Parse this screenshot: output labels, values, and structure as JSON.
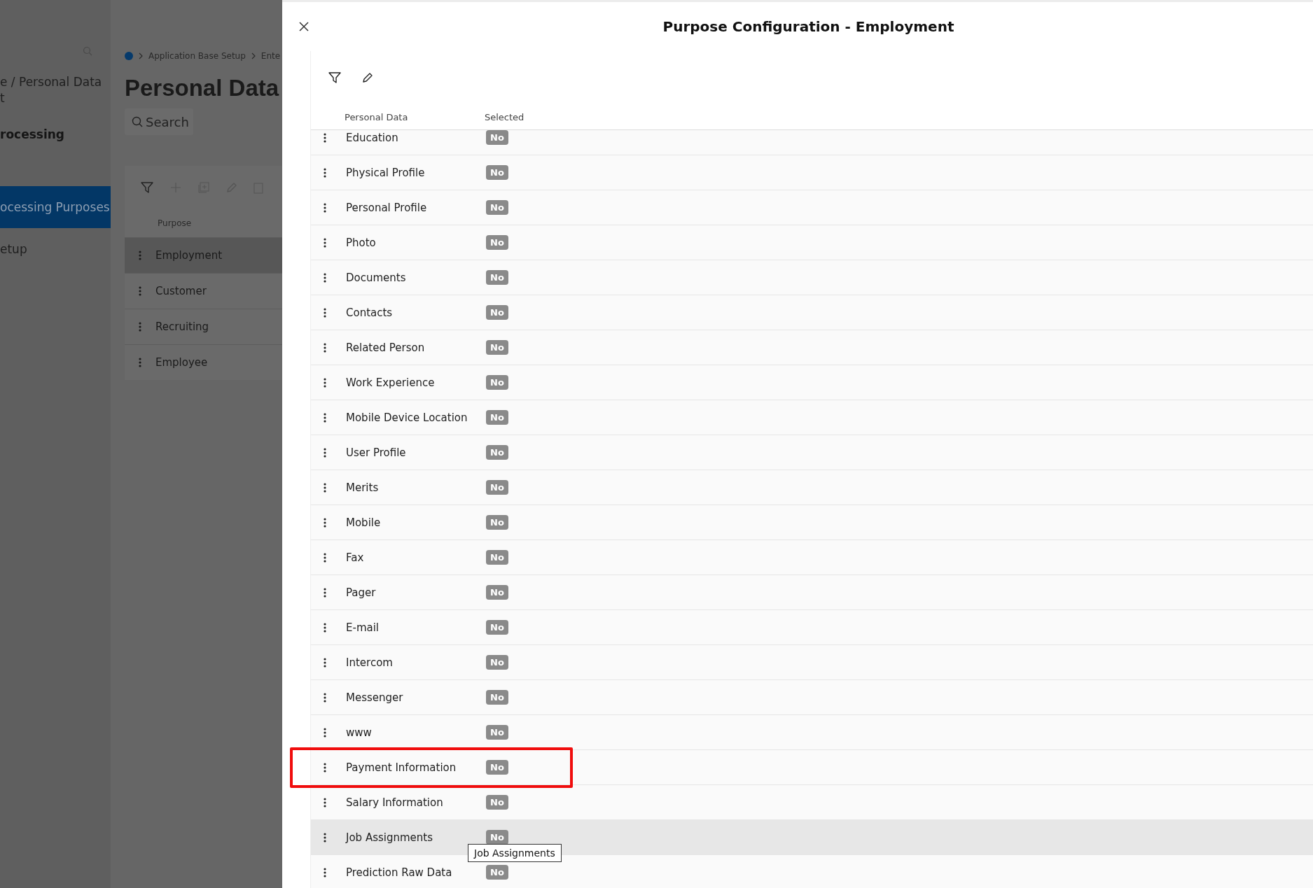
{
  "background": {
    "sidebar": {
      "heading_lines": [
        "e / Personal Data",
        "t"
      ],
      "section": "rocessing",
      "items": [
        {
          "label": "ocessing Purposes",
          "selected": true
        },
        {
          "label": "etup",
          "selected": false
        }
      ]
    },
    "breadcrumb": [
      "Application Base Setup",
      "Ente"
    ],
    "page_title": "Personal Data",
    "search_button": "Search",
    "table": {
      "column": "Purpose",
      "rows": [
        {
          "label": "Employment",
          "selected": true
        },
        {
          "label": "Customer",
          "selected": false
        },
        {
          "label": "Recruiting",
          "selected": false
        },
        {
          "label": "Employee",
          "selected": false
        }
      ]
    }
  },
  "dialog": {
    "title": "Purpose Configuration - Employment",
    "columns": [
      "Personal Data",
      "Selected"
    ],
    "rows": [
      {
        "name": "Education",
        "selected_value": "No",
        "highlighted": false,
        "hovered": false
      },
      {
        "name": "Physical Profile",
        "selected_value": "No",
        "highlighted": false,
        "hovered": false
      },
      {
        "name": "Personal Profile",
        "selected_value": "No",
        "highlighted": false,
        "hovered": false
      },
      {
        "name": "Photo",
        "selected_value": "No",
        "highlighted": false,
        "hovered": false
      },
      {
        "name": "Documents",
        "selected_value": "No",
        "highlighted": false,
        "hovered": false
      },
      {
        "name": "Contacts",
        "selected_value": "No",
        "highlighted": false,
        "hovered": false
      },
      {
        "name": "Related Person",
        "selected_value": "No",
        "highlighted": false,
        "hovered": false
      },
      {
        "name": "Work Experience",
        "selected_value": "No",
        "highlighted": false,
        "hovered": false
      },
      {
        "name": "Mobile Device Location",
        "selected_value": "No",
        "highlighted": false,
        "hovered": false
      },
      {
        "name": "User Profile",
        "selected_value": "No",
        "highlighted": false,
        "hovered": false
      },
      {
        "name": "Merits",
        "selected_value": "No",
        "highlighted": false,
        "hovered": false
      },
      {
        "name": "Mobile",
        "selected_value": "No",
        "highlighted": false,
        "hovered": false
      },
      {
        "name": "Fax",
        "selected_value": "No",
        "highlighted": false,
        "hovered": false
      },
      {
        "name": "Pager",
        "selected_value": "No",
        "highlighted": false,
        "hovered": false
      },
      {
        "name": "E-mail",
        "selected_value": "No",
        "highlighted": false,
        "hovered": false
      },
      {
        "name": "Intercom",
        "selected_value": "No",
        "highlighted": false,
        "hovered": false
      },
      {
        "name": "Messenger",
        "selected_value": "No",
        "highlighted": false,
        "hovered": false
      },
      {
        "name": "www",
        "selected_value": "No",
        "highlighted": false,
        "hovered": false
      },
      {
        "name": "Payment Information",
        "selected_value": "No",
        "highlighted": true,
        "hovered": false
      },
      {
        "name": "Salary Information",
        "selected_value": "No",
        "highlighted": false,
        "hovered": false
      },
      {
        "name": "Job Assignments",
        "selected_value": "No",
        "highlighted": false,
        "hovered": true,
        "tooltip": "Job Assignments"
      },
      {
        "name": "Prediction Raw Data",
        "selected_value": "No",
        "highlighted": false,
        "hovered": false
      }
    ]
  }
}
